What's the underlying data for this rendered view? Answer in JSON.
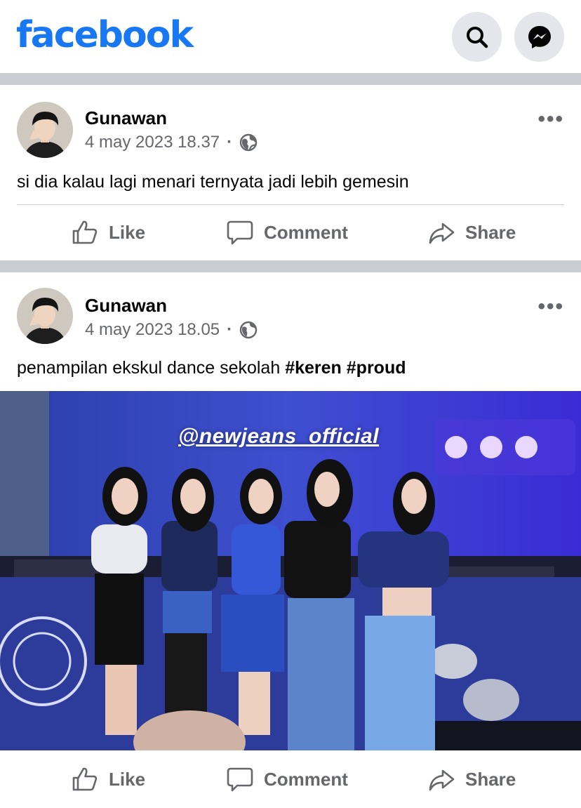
{
  "app": {
    "logo_text": "facebook",
    "brand_color": "#1877f2",
    "header_icons": [
      "search-icon",
      "messenger-icon"
    ]
  },
  "posts": [
    {
      "author": "Gunawan",
      "timestamp": "4 may 2023 18.37",
      "audience_icon": "globe-icon",
      "text": "si dia kalau lagi menari ternyata jadi lebih gemesin",
      "hashtags": [],
      "actions": {
        "like": "Like",
        "comment": "Comment",
        "share": "Share"
      }
    },
    {
      "author": "Gunawan",
      "timestamp": "4 may 2023 18.05",
      "audience_icon": "globe-icon",
      "text": "penampilan ekskul dance sekolah",
      "hashtags": [
        "#keren",
        "#proud"
      ],
      "photo": {
        "watermark": "@newjeans_official"
      },
      "actions": {
        "like": "Like",
        "comment": "Comment",
        "share": "Share"
      }
    }
  ]
}
